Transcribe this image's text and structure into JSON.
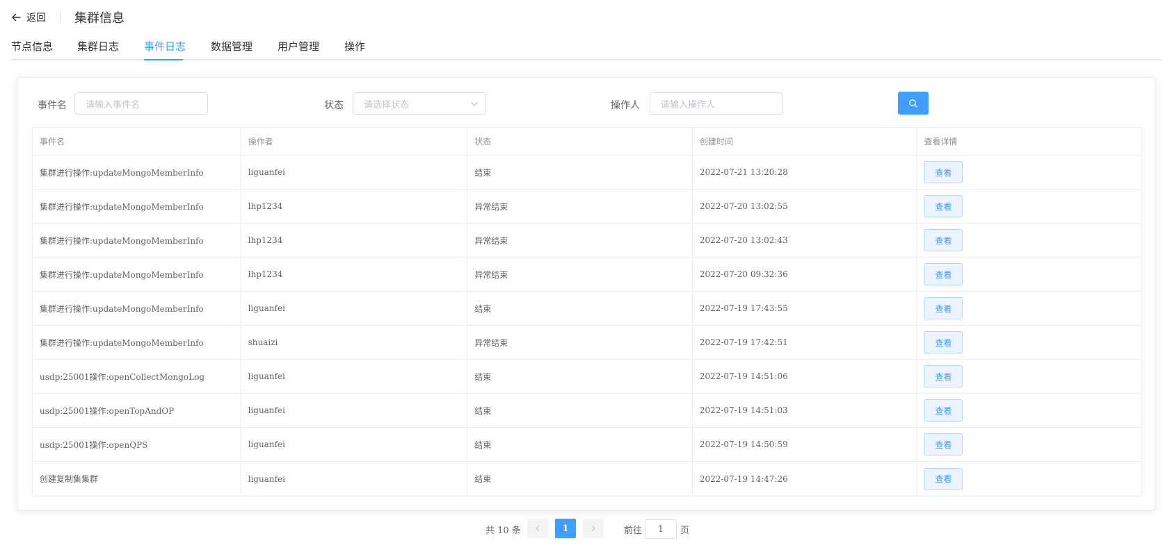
{
  "header": {
    "back_label": "返回",
    "title": "集群信息"
  },
  "tabs": [
    {
      "label": "节点信息"
    },
    {
      "label": "集群日志"
    },
    {
      "label": "事件日志",
      "active": true
    },
    {
      "label": "数据管理"
    },
    {
      "label": "用户管理"
    },
    {
      "label": "操作"
    }
  ],
  "filters": {
    "event_name_label": "事件名",
    "event_name_placeholder": "请输入事件名",
    "status_label": "状态",
    "status_placeholder": "请选择状态",
    "operator_label": "操作人",
    "operator_placeholder": "请输入操作人"
  },
  "table": {
    "columns": [
      "事件名",
      "操作者",
      "状态",
      "创建时间",
      "查看详情"
    ],
    "view_label": "查看",
    "rows": [
      {
        "event": "集群进行操作:updateMongoMemberInfo",
        "operator": "liguanfei",
        "status": "结束",
        "created": "2022-07-21 13:20:28"
      },
      {
        "event": "集群进行操作:updateMongoMemberInfo",
        "operator": "lhp1234",
        "status": "异常结束",
        "created": "2022-07-20 13:02:55"
      },
      {
        "event": "集群进行操作:updateMongoMemberInfo",
        "operator": "lhp1234",
        "status": "异常结束",
        "created": "2022-07-20 13:02:43"
      },
      {
        "event": "集群进行操作:updateMongoMemberInfo",
        "operator": "lhp1234",
        "status": "异常结束",
        "created": "2022-07-20 09:32:36"
      },
      {
        "event": "集群进行操作:updateMongoMemberInfo",
        "operator": "liguanfei",
        "status": "结束",
        "created": "2022-07-19 17:43:55"
      },
      {
        "event": "集群进行操作:updateMongoMemberInfo",
        "operator": "shuaizi",
        "status": "异常结束",
        "created": "2022-07-19 17:42:51"
      },
      {
        "event": "usdp:25001操作:openCollectMongoLog",
        "operator": "liguanfei",
        "status": "结束",
        "created": "2022-07-19 14:51:06"
      },
      {
        "event": "usdp:25001操作:openTopAndOP",
        "operator": "liguanfei",
        "status": "结束",
        "created": "2022-07-19 14:51:03"
      },
      {
        "event": "usdp:25001操作:openQPS",
        "operator": "liguanfei",
        "status": "结束",
        "created": "2022-07-19 14:50:59"
      },
      {
        "event": "创建复制集集群",
        "operator": "liguanfei",
        "status": "结束",
        "created": "2022-07-19 14:47:26"
      }
    ]
  },
  "pagination": {
    "total_label": "共 10 条",
    "current_page": "1",
    "goto_label": "前往",
    "goto_value": "1",
    "page_label": "页"
  },
  "colors": {
    "accent": "#409eff",
    "text": "#303133",
    "muted": "#909399"
  }
}
